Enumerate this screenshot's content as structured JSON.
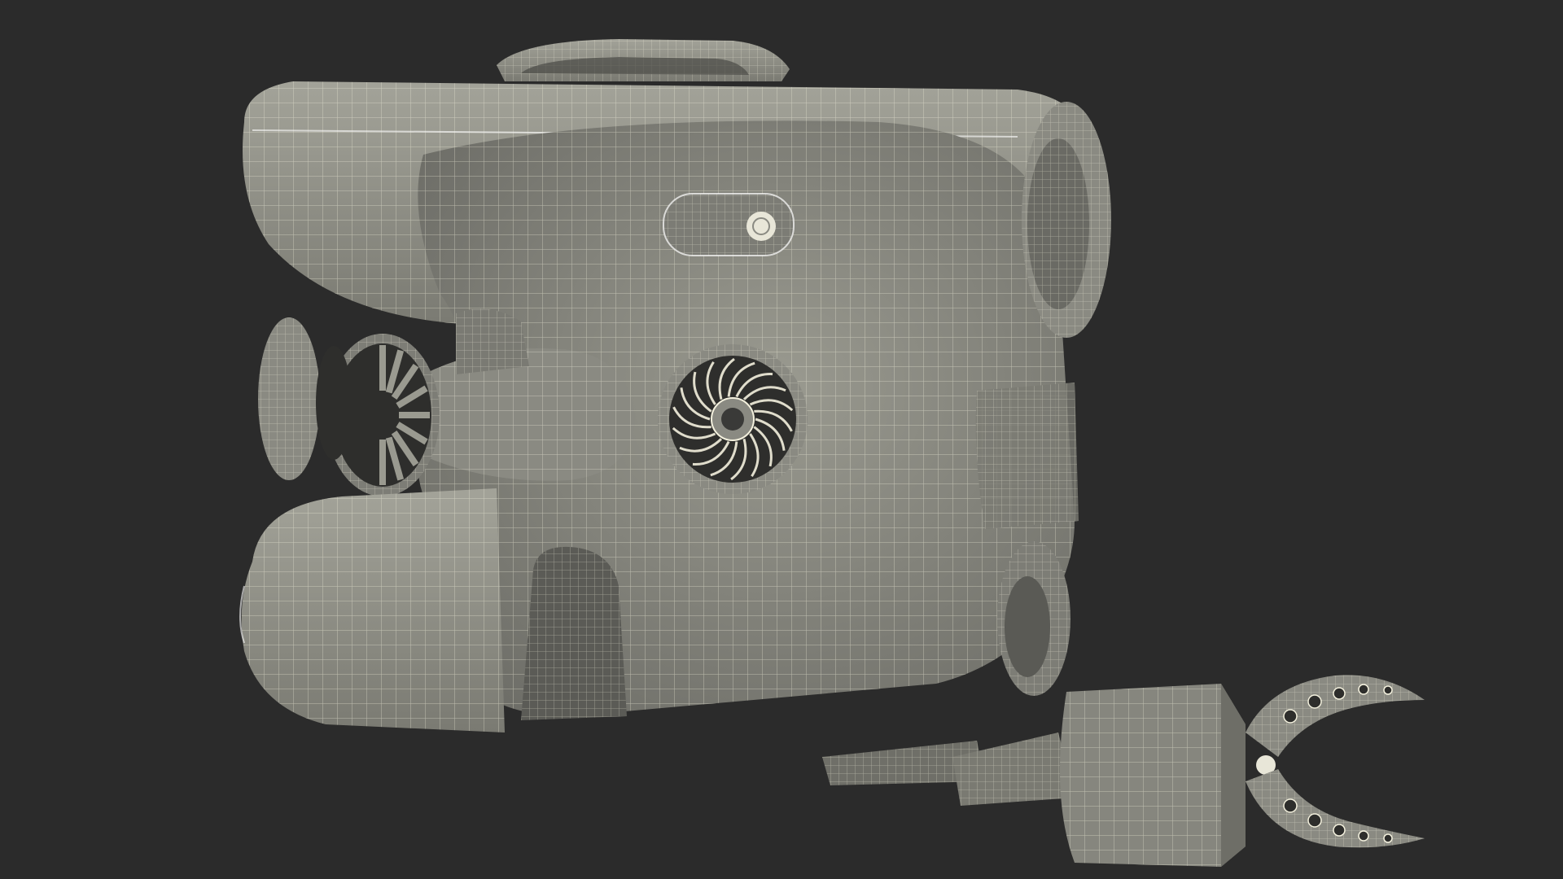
{
  "scene": {
    "subject": "underwater-drone-wireframe",
    "colors": {
      "background": "#2b2b2b",
      "body_fill": "#8f8f86",
      "body_shade": "#6f6f68",
      "hole_fill": "#2e2e2c",
      "wire": "#f4f1de",
      "edge": "#ffffff"
    }
  }
}
